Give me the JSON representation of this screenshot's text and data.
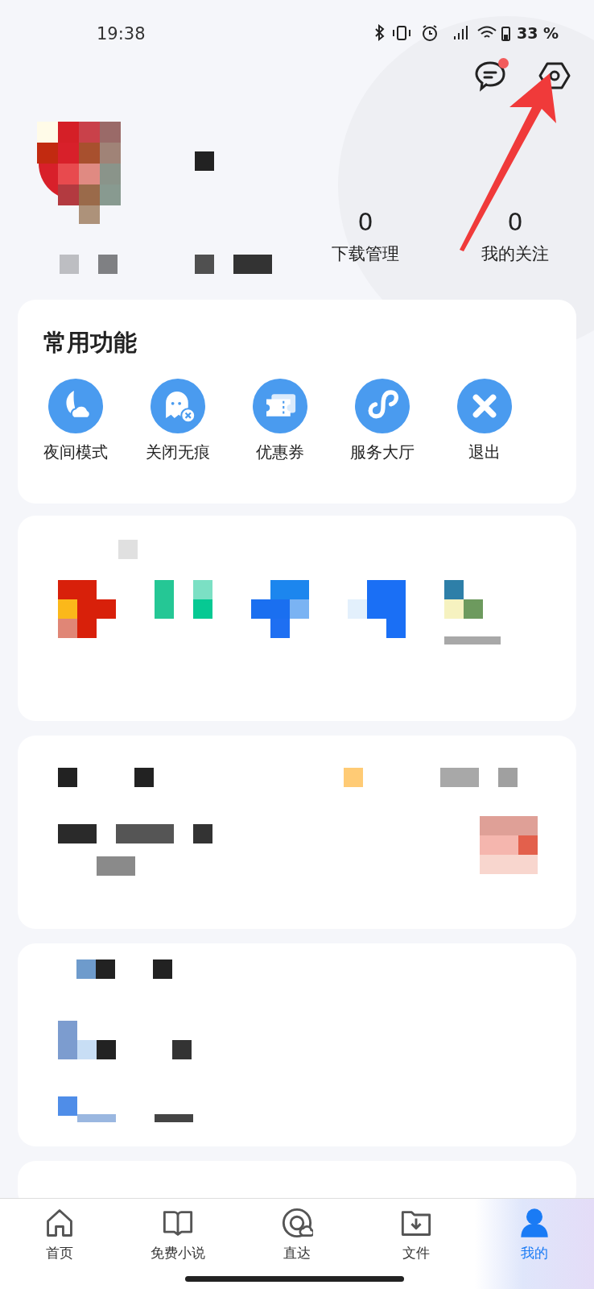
{
  "status_bar": {
    "time": "19:38",
    "battery": "33 %"
  },
  "header": {
    "messages_unread": true
  },
  "stats": [
    {
      "count": "0",
      "label": "下载管理"
    },
    {
      "count": "0",
      "label": "我的关注"
    }
  ],
  "functions": {
    "title": "常用功能",
    "items": [
      {
        "kind": "night",
        "label": "夜间模式"
      },
      {
        "kind": "ghost",
        "label": "关闭无痕"
      },
      {
        "kind": "coupon",
        "label": "优惠券"
      },
      {
        "kind": "link",
        "label": "服务大厅"
      },
      {
        "kind": "exit",
        "label": "退出"
      }
    ]
  },
  "bottom_nav": [
    {
      "kind": "home",
      "label": "首页",
      "selected": false
    },
    {
      "kind": "book",
      "label": "免费小说",
      "selected": false
    },
    {
      "kind": "direct",
      "label": "直达",
      "selected": false
    },
    {
      "kind": "file",
      "label": "文件",
      "selected": false
    },
    {
      "kind": "me",
      "label": "我的",
      "selected": true
    }
  ]
}
